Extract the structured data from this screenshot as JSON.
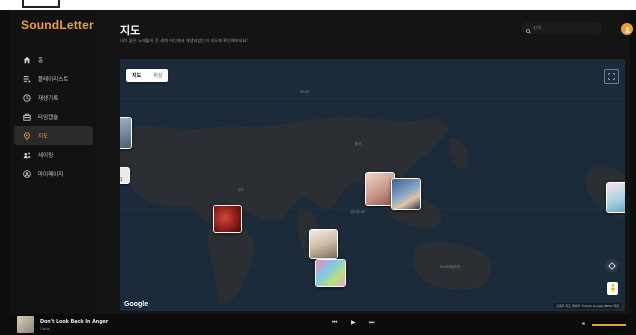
{
  "app": {
    "name": "SoundLetter"
  },
  "nav": {
    "items": [
      {
        "label": "홈",
        "icon": "home-icon",
        "active": false
      },
      {
        "label": "플레이리스트",
        "icon": "playlist-icon",
        "active": false
      },
      {
        "label": "재생기록",
        "icon": "history-icon",
        "active": false
      },
      {
        "label": "타임캡슐",
        "icon": "timecapsule-icon",
        "active": false
      },
      {
        "label": "지도",
        "icon": "map-pin-icon",
        "active": true
      },
      {
        "label": "세이링",
        "icon": "share-icon",
        "active": false
      },
      {
        "label": "마이페이지",
        "icon": "user-icon",
        "active": false
      }
    ]
  },
  "page": {
    "title": "지도",
    "subtitle": "내가 들은 노래들이 전 세계 어디에서 재생되었는지 지도에 확인해보세요!"
  },
  "search": {
    "placeholder": "검색"
  },
  "map": {
    "tabs": [
      {
        "label": "지도",
        "active": true
      },
      {
        "label": "위성",
        "active": false
      }
    ],
    "brand": "Google",
    "attribution": "단축키  지도 데이터 ©2025 Google INEGI  약관",
    "cluster_count": "1"
  },
  "player": {
    "song": "Don't Look Back In Anger",
    "artist": "Oasis",
    "volume_fraction": 1.0
  },
  "colors": {
    "accent": "#e8a03a",
    "map_bg": "#1d2c3c"
  }
}
